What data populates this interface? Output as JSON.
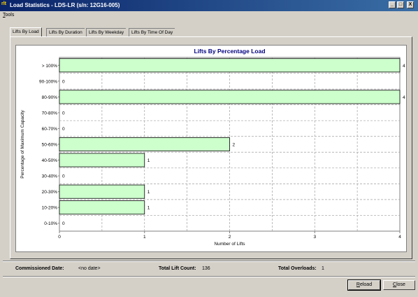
{
  "window": {
    "icon_text": "rlt",
    "title": "Load Statistics - LDS-LR (s/n: 12G16-005)",
    "controls": {
      "minimize": "_",
      "maximize": "□",
      "close": "X"
    }
  },
  "menu": {
    "items": [
      {
        "mnemonic": "T",
        "rest": "ools"
      }
    ]
  },
  "tabs": [
    {
      "label": "Lifts By Load",
      "active": true
    },
    {
      "label": "Lifts By Duration",
      "active": false
    },
    {
      "label": "Lifts By Weekday",
      "active": false
    },
    {
      "label": "Lifts By Time Of Day",
      "active": false
    }
  ],
  "chart_data": {
    "type": "bar",
    "orientation": "horizontal",
    "title": "Lifts By Percentage Load",
    "xlabel": "Number of Lifts",
    "ylabel": "Percentage of Maximum Capacity",
    "categories": [
      "> 100%",
      "90-100%",
      "80-90%",
      "70-80%",
      "60-70%",
      "50-60%",
      "40-50%",
      "30-40%",
      "20-30%",
      "10-20%",
      "0-10%"
    ],
    "values": [
      4,
      0,
      4,
      0,
      0,
      2,
      1,
      0,
      1,
      1,
      0
    ],
    "xlim": [
      0,
      4
    ],
    "xticks": [
      "0",
      "1",
      "2",
      "3",
      "4"
    ],
    "grid": true,
    "bar_color": "#ccffcc",
    "title_color": "#000080"
  },
  "footer": {
    "commissioned_label": "Commissioned Date:",
    "commissioned_value": "<no date>",
    "total_lift_label": "Total Lift Count:",
    "total_lift_value": "136",
    "total_overloads_label": "Total Overloads:",
    "total_overloads_value": "1"
  },
  "buttons": {
    "reload": {
      "mnemonic": "R",
      "rest": "eload"
    },
    "close": {
      "mnemonic": "C",
      "rest": "lose"
    }
  }
}
